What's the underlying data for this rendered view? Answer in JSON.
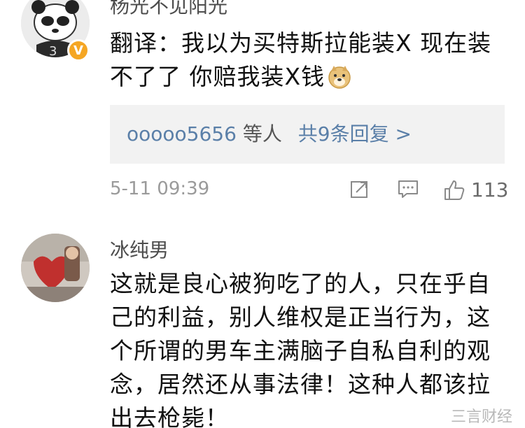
{
  "comments": [
    {
      "username": "杨光不见阳光",
      "text": "翻译：我以为买特斯拉能装X 现在装不了了 你赔我装X钱",
      "emoji": "doge-emoji-icon",
      "verified_badge": "V",
      "replies": {
        "user": "ooooo5656",
        "others": "等人",
        "total": "共9条回复 >"
      },
      "time": "5-11 09:39",
      "likes": "113"
    },
    {
      "username": "冰纯男",
      "text": "这就是良心被狗吃了的人，只在乎自己的利益，别人维权是正当行为，这个所谓的男车主满脑子自私自利的观念，居然还从事法律！这种人都该拉出去枪毙！"
    }
  ],
  "watermark": "三言财经",
  "colors": {
    "link": "#5a7fa8",
    "badge": "#f5a623",
    "meta": "#9a9a9a",
    "reply_bg": "#f2f2f2"
  }
}
